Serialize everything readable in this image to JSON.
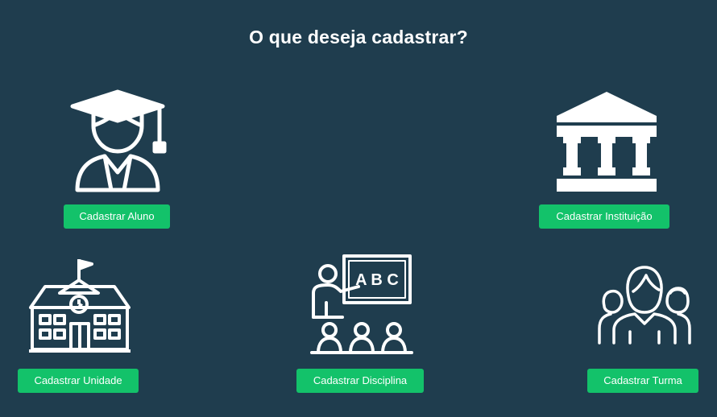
{
  "title": "O que deseja cadastrar?",
  "colors": {
    "background": "#1f3d4e",
    "accent": "#13c26a",
    "text": "#ffffff"
  },
  "options": [
    {
      "icon": "graduate-student-icon",
      "label": "Cadastrar Aluno"
    },
    {
      "icon": "institution-building-icon",
      "label": "Cadastrar Instituição"
    },
    {
      "icon": "school-building-icon",
      "label": "Cadastrar Unidade"
    },
    {
      "icon": "teacher-classroom-icon",
      "label": "Cadastrar Disciplina"
    },
    {
      "icon": "group-people-icon",
      "label": "Cadastrar Turma"
    }
  ]
}
